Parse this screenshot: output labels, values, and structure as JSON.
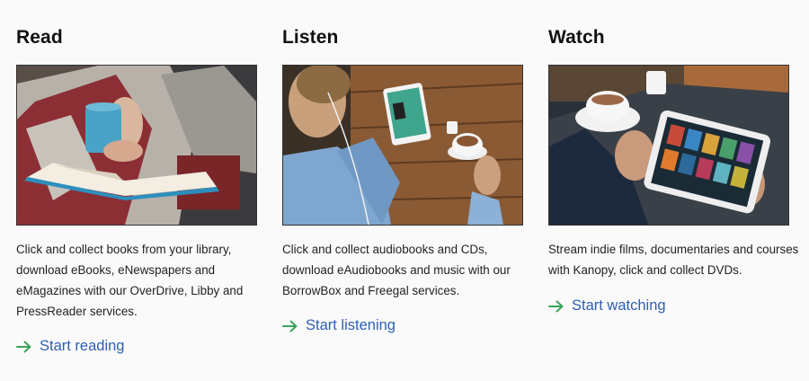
{
  "columns": [
    {
      "title": "Read",
      "description_lines": [
        "Click and collect books from your library,",
        "download eBooks, eNewspapers and",
        "eMagazines with our OverDrive, Libby and",
        "PressReader services."
      ],
      "cta_label": "Start reading"
    },
    {
      "title": "Listen",
      "description_lines": [
        "Click and collect audiobooks and CDs,",
        "download eAudiobooks and music with our",
        "BorrowBox and Freegal services."
      ],
      "cta_label": "Start listening"
    },
    {
      "title": "Watch",
      "description_lines": [
        "Stream indie films, documentaries and courses",
        "with Kanopy, click and collect DVDs."
      ],
      "cta_label": "Start watching"
    }
  ],
  "colors": {
    "link": "#2f5fb3",
    "arrow": "#3aa35a",
    "background": "#fafafa"
  },
  "icons": [
    "arrow-right-icon"
  ]
}
